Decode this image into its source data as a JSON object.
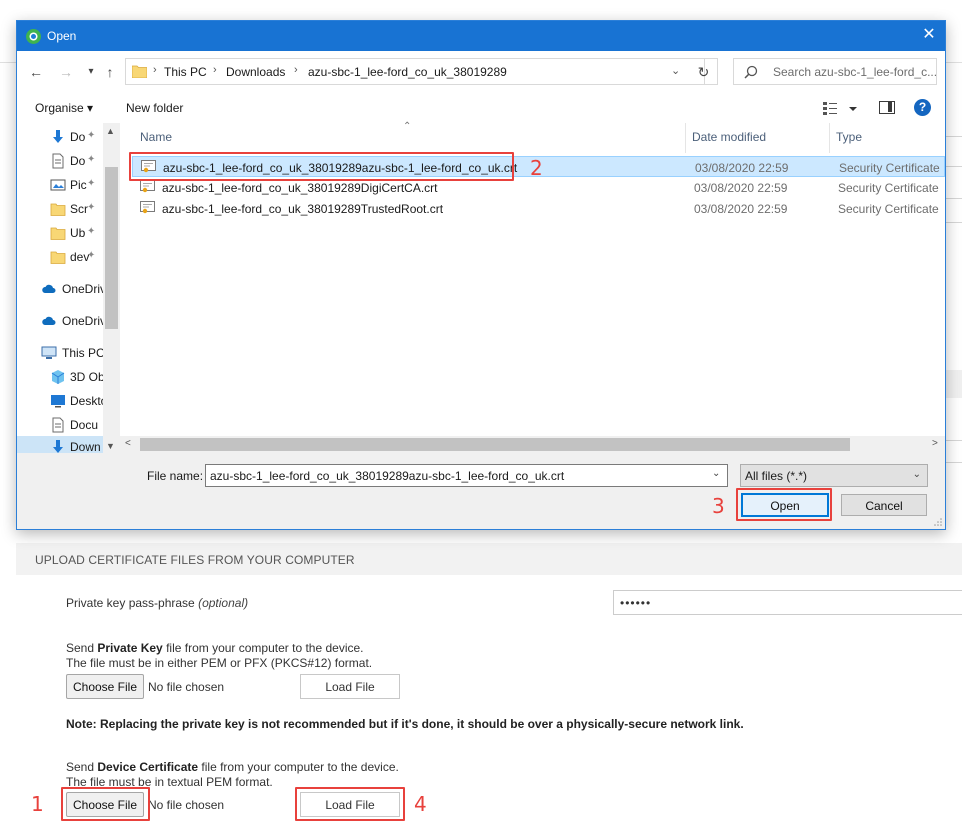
{
  "dialog": {
    "title": "Open",
    "nav": {
      "back": "←",
      "forward": "→",
      "recent": "▾",
      "up": "↑"
    },
    "address": {
      "segments": [
        "This PC",
        "Downloads",
        "azu-sbc-1_lee-ford_co_uk_38019289"
      ],
      "separator": "›",
      "dropdown": "⌄",
      "refresh": "↻"
    },
    "search": {
      "placeholder": "Search azu-sbc-1_lee-ford_c..."
    },
    "toolbar": {
      "organise": "Organise ▾",
      "new_folder": "New folder",
      "help": "?"
    },
    "nav_pane": {
      "items": [
        {
          "label": "Do",
          "icon": "download-arrow-icon",
          "pinned": true
        },
        {
          "label": "Do",
          "icon": "document-icon",
          "pinned": true
        },
        {
          "label": "Pic",
          "icon": "pictures-icon",
          "pinned": true
        },
        {
          "label": "Scr",
          "icon": "folder-icon",
          "pinned": true
        },
        {
          "label": "Ub",
          "icon": "folder-icon",
          "pinned": true
        },
        {
          "label": "dev",
          "icon": "folder-icon",
          "pinned": true
        },
        {
          "label": "OneDriv",
          "icon": "cloud-icon",
          "pinned": false
        },
        {
          "label": "OneDriv",
          "icon": "cloud-icon",
          "pinned": false
        },
        {
          "label": "This PC",
          "icon": "computer-icon",
          "pinned": false
        },
        {
          "label": "3D Ob",
          "icon": "cube-icon",
          "pinned": false
        },
        {
          "label": "Deskto",
          "icon": "desktop-icon",
          "pinned": false
        },
        {
          "label": "Docu",
          "icon": "document-icon",
          "pinned": false
        },
        {
          "label": "Down",
          "icon": "download-arrow-icon",
          "pinned": false,
          "selected": true
        }
      ],
      "pin_glyph": "📌"
    },
    "columns": {
      "name": "Name",
      "date": "Date modified",
      "type": "Type"
    },
    "files": [
      {
        "name": "azu-sbc-1_lee-ford_co_uk_38019289azu-sbc-1_lee-ford_co_uk.crt",
        "date": "03/08/2020 22:59",
        "type": "Security Certificate",
        "selected": true
      },
      {
        "name": "azu-sbc-1_lee-ford_co_uk_38019289DigiCertCA.crt",
        "date": "03/08/2020 22:59",
        "type": "Security Certificate"
      },
      {
        "name": "azu-sbc-1_lee-ford_co_uk_38019289TrustedRoot.crt",
        "date": "03/08/2020 22:59",
        "type": "Security Certificate"
      }
    ],
    "file_name_label": "File name:",
    "file_name_value": "azu-sbc-1_lee-ford_co_uk_38019289azu-sbc-1_lee-ford_co_uk.crt",
    "file_type": "All files (*.*)",
    "open_label": "Open",
    "cancel_label": "Cancel"
  },
  "page": {
    "upload_header": "UPLOAD CERTIFICATE FILES FROM YOUR COMPUTER",
    "passphrase_label": "Private key pass-phrase",
    "passphrase_optional": "(optional)",
    "passphrase_value": "••••••",
    "private_key": {
      "line1_pre": "Send ",
      "line1_bold": "Private Key",
      "line1_post": " file from your computer to the device.",
      "line2": "The file must be in either PEM or PFX (PKCS#12) format.",
      "choose": "Choose File",
      "no_file": "No file chosen",
      "load": "Load File"
    },
    "note": "Note: Replacing the private key is not recommended but if it's done, it should be over a physically-secure network link.",
    "device_cert": {
      "line1_pre": "Send ",
      "line1_bold": "Device Certificate",
      "line1_post": " file from your computer to the device.",
      "line2": "The file must be in textual PEM format.",
      "choose": "Choose File",
      "no_file": "No file chosen",
      "load": "Load File"
    }
  },
  "annotations": [
    "1",
    "2",
    "3",
    "4"
  ],
  "colors": {
    "titlebar": "#1873d3",
    "annotation": "#e8413c",
    "selection": "#cce8ff"
  }
}
